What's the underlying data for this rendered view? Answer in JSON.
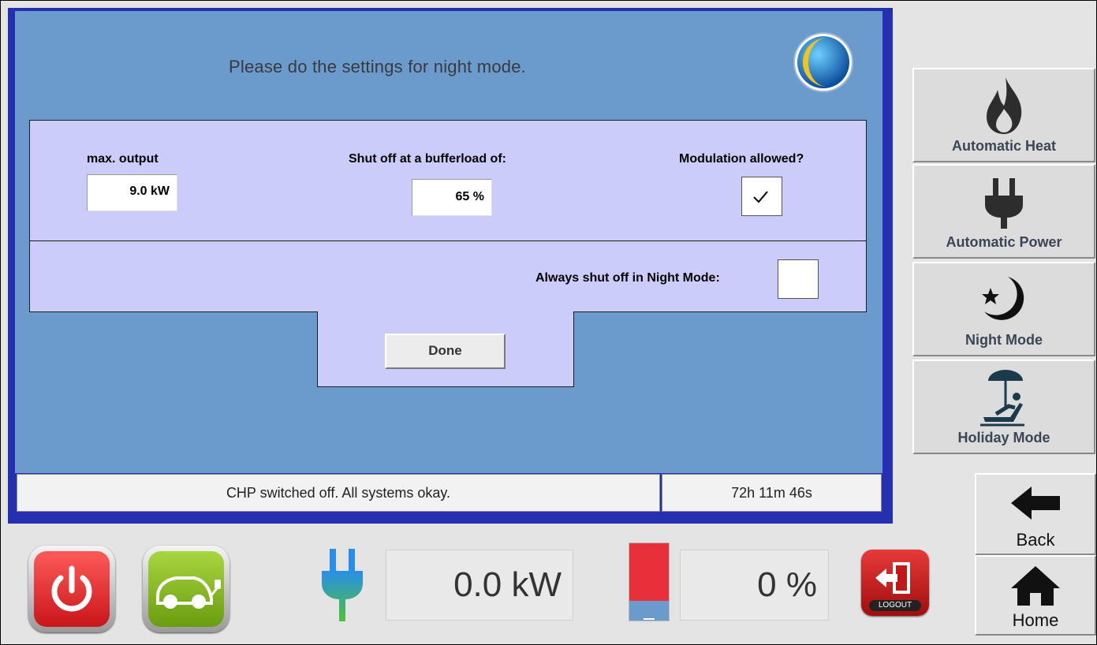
{
  "title": "Please do the settings for night mode.",
  "settings": {
    "max_output_label": "max. output",
    "max_output_value": "9.0 kW",
    "shutoff_label": "Shut off at a bufferload of:",
    "shutoff_value": "65 %",
    "modulation_label": "Modulation allowed?",
    "modulation_checked": true,
    "always_shutoff_label": "Always shut off in Night Mode:",
    "always_shutoff_checked": false
  },
  "done_label": "Done",
  "status": {
    "message": "CHP switched off. All systems okay.",
    "timer": "72h 11m 46s"
  },
  "side_menu": [
    {
      "label": "Automatic Heat",
      "icon": "flame-icon"
    },
    {
      "label": "Automatic Power",
      "icon": "plug-icon"
    },
    {
      "label": "Night Mode",
      "icon": "moon-star-icon"
    },
    {
      "label": "Holiday Mode",
      "icon": "beach-chair-icon"
    }
  ],
  "nav": {
    "back_label": "Back",
    "home_label": "Home"
  },
  "bottom": {
    "power_value": "0.0 kW",
    "buffer_value": "0 %",
    "buffer_level": 0.0,
    "logout_label": "LOGOUT"
  },
  "colors": {
    "panel_border": "#2430b0",
    "panel_bg": "#6b9bcc",
    "settings_bg": "#ccccfa",
    "power_button": "#d41e1e",
    "ecar_button": "#7cad1a",
    "buffer_hot": "#e8303a",
    "buffer_cold": "#6b9bcc"
  }
}
